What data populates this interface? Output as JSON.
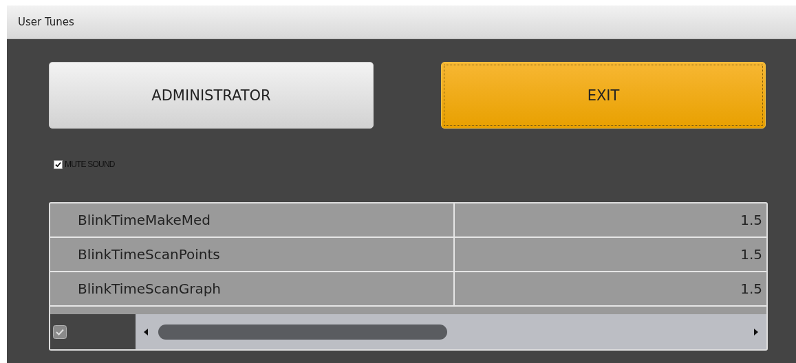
{
  "window": {
    "title": "User Tunes"
  },
  "buttons": [
    {
      "label": "ADMINISTRATOR",
      "kind": "normal"
    },
    {
      "label": "EXIT",
      "kind": "primary"
    }
  ],
  "mute_sound": {
    "label": "MUTE SOUND",
    "checked": true
  },
  "table": {
    "rows": [
      {
        "name": "BlinkTimeMakeMed",
        "value": "1.5"
      },
      {
        "name": "BlinkTimeScanPoints",
        "value": "1.5"
      },
      {
        "name": "BlinkTimeScanGraph",
        "value": "1.5"
      }
    ]
  }
}
